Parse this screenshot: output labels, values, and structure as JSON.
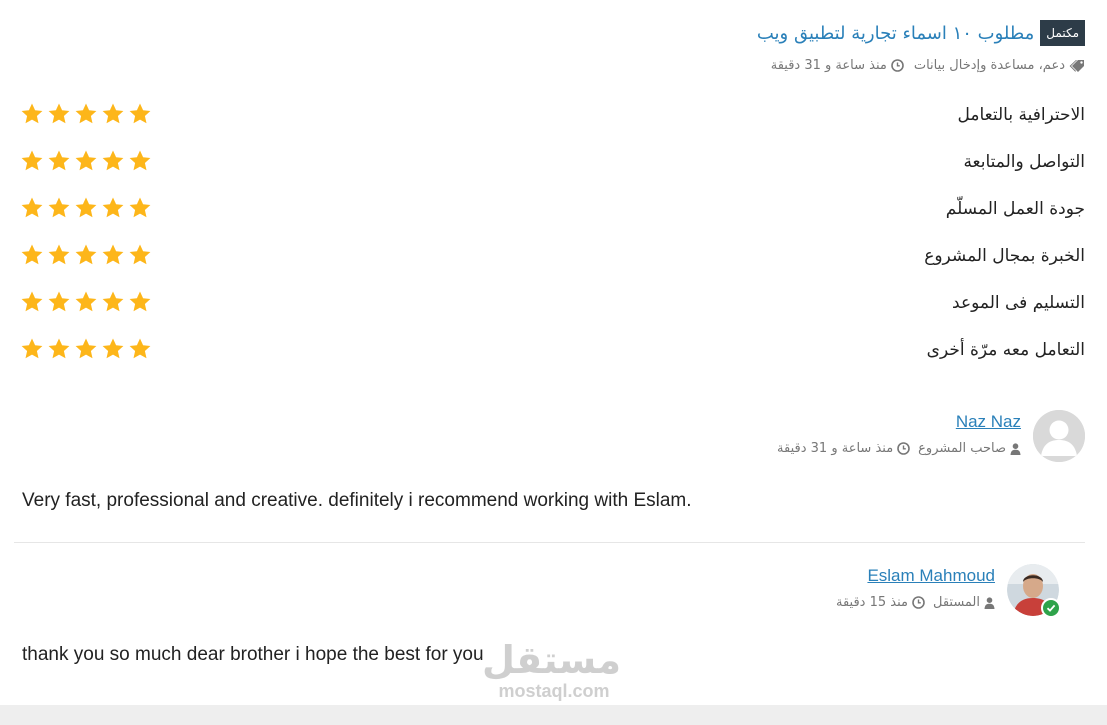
{
  "project": {
    "status_badge": "مكتمل",
    "title": "مطلوب ١٠ اسماء تجارية لتطبيق ويب",
    "category": "دعم، مساعدة وإدخال بيانات",
    "time_ago": "منذ ساعة و 31 دقيقة"
  },
  "ratings": [
    {
      "label": "الاحترافية بالتعامل",
      "stars": 5
    },
    {
      "label": "التواصل والمتابعة",
      "stars": 5
    },
    {
      "label": "جودة العمل المسلّم",
      "stars": 5
    },
    {
      "label": "الخبرة بمجال المشروع",
      "stars": 5
    },
    {
      "label": "التسليم فى الموعد",
      "stars": 5
    },
    {
      "label": "التعامل معه مرّة أخرى",
      "stars": 5
    }
  ],
  "colors": {
    "star": "#fdb61a",
    "link": "#2a80b9",
    "badge_bg": "#2d3c48",
    "verified": "#2ea34a"
  },
  "client_review": {
    "name": "Naz Naz",
    "role": "صاحب المشروع",
    "time_ago": "منذ ساعة و 31 دقيقة",
    "text": "Very fast, professional and creative. definitely i recommend working with Eslam."
  },
  "freelancer_reply": {
    "name": "Eslam Mahmoud",
    "role": "المستقل",
    "time_ago": "منذ 15 دقيقة",
    "text": "thank you so much dear brother i hope the best for you"
  },
  "watermark": {
    "arabic": "مستقل",
    "latin": "mostaql.com"
  }
}
